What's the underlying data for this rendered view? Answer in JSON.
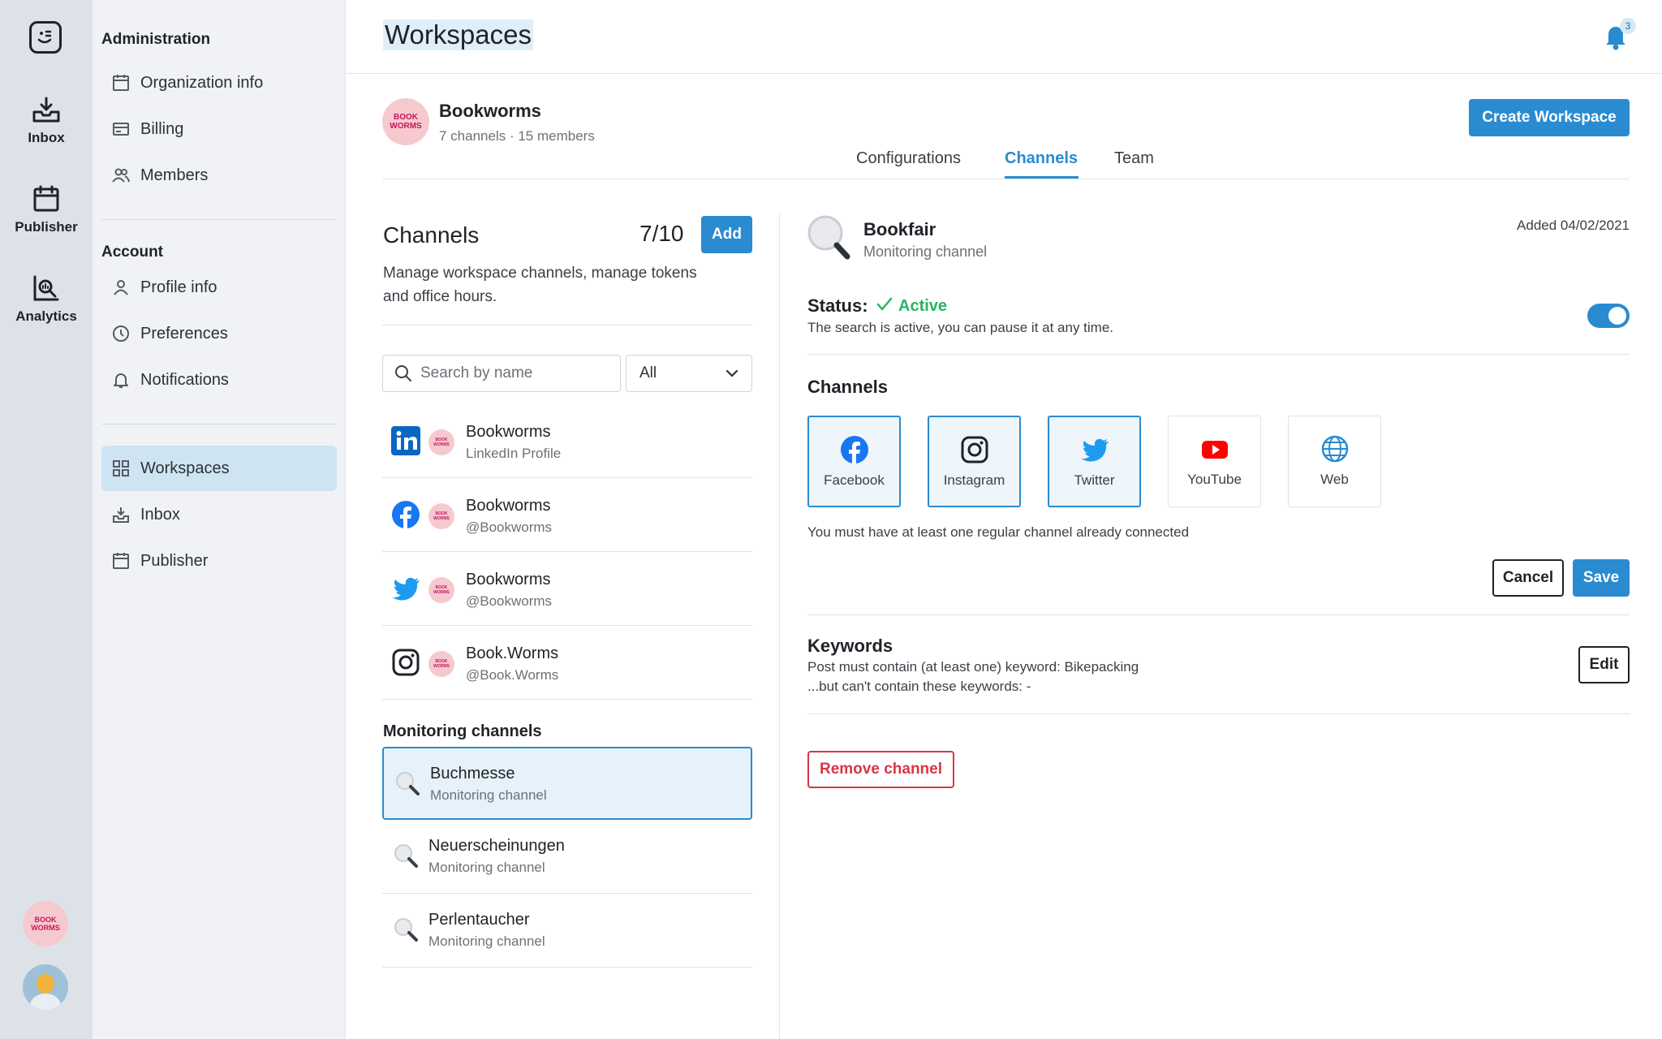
{
  "rail": {
    "items": [
      {
        "label": "Inbox"
      },
      {
        "label": "Publisher"
      },
      {
        "label": "Analytics"
      }
    ],
    "workspace_avatar_text": "BOOK WORMS"
  },
  "sidebar": {
    "administration_heading": "Administration",
    "admin_items": [
      {
        "label": "Organization info",
        "icon": "calendar-icon"
      },
      {
        "label": "Billing",
        "icon": "billing-icon"
      },
      {
        "label": "Members",
        "icon": "members-icon"
      }
    ],
    "account_heading": "Account",
    "account_items": [
      {
        "label": "Profile info",
        "icon": "person-icon"
      },
      {
        "label": "Preferences",
        "icon": "clock-icon"
      },
      {
        "label": "Notifications",
        "icon": "bell-icon"
      }
    ],
    "nav_items": [
      {
        "label": "Workspaces",
        "icon": "grid-icon",
        "active": true
      },
      {
        "label": "Inbox",
        "icon": "inbox-icon"
      },
      {
        "label": "Publisher",
        "icon": "calendar-icon"
      }
    ]
  },
  "header": {
    "title": "Workspaces",
    "notification_count": "3"
  },
  "workspace": {
    "logo_text": "BOOK WORMS",
    "name": "Bookworms",
    "meta": "7 channels · 15 members",
    "create_button": "Create Workspace",
    "tabs": [
      {
        "label": "Configurations"
      },
      {
        "label": "Channels",
        "active": true
      },
      {
        "label": "Team"
      }
    ]
  },
  "channels_list": {
    "title": "Channels",
    "count": "7/10",
    "add_button": "Add",
    "description": "Manage workspace channels, manage tokens and office hours.",
    "search_placeholder": "Search by name",
    "filter_value": "All",
    "channels": [
      {
        "name": "Bookworms",
        "sub": "LinkedIn Profile",
        "network": "linkedin"
      },
      {
        "name": "Bookworms",
        "sub": "@Bookworms",
        "network": "facebook"
      },
      {
        "name": "Bookworms",
        "sub": "@Bookworms",
        "network": "twitter"
      },
      {
        "name": "Book.Worms",
        "sub": "@Book.Worms",
        "network": "instagram"
      }
    ],
    "mini_avatar_text": "BOOK WORMS",
    "monitoring_title": "Monitoring channels",
    "monitoring": [
      {
        "name": "Buchmesse",
        "sub": "Monitoring channel",
        "selected": true
      },
      {
        "name": "Neuerscheinungen",
        "sub": "Monitoring channel"
      },
      {
        "name": "Perlentaucher",
        "sub": "Monitoring channel"
      }
    ]
  },
  "detail": {
    "name": "Bookfair",
    "sub": "Monitoring channel",
    "added": "Added 04/02/2021",
    "status_label": "Status:",
    "status_value": "Active",
    "status_desc": "The search is active, you can pause it at any time.",
    "toggle_on": true,
    "channels_title": "Channels",
    "networks": [
      {
        "label": "Facebook",
        "selected": true
      },
      {
        "label": "Instagram",
        "selected": true
      },
      {
        "label": "Twitter",
        "selected": true
      },
      {
        "label": "YouTube",
        "selected": false
      },
      {
        "label": "Web",
        "selected": false
      }
    ],
    "network_note": "You must have at least one regular channel already connected",
    "cancel_button": "Cancel",
    "save_button": "Save",
    "keywords_title": "Keywords",
    "keywords_line1": "Post must contain (at least one) keyword: Bikepacking",
    "keywords_line2": "...but can't contain these keywords: -",
    "edit_button": "Edit",
    "remove_button": "Remove channel"
  },
  "colors": {
    "accent": "#2a8bd0",
    "active_green": "#29b363",
    "danger": "#d93644",
    "brand_pink": "#f6c9cf"
  }
}
